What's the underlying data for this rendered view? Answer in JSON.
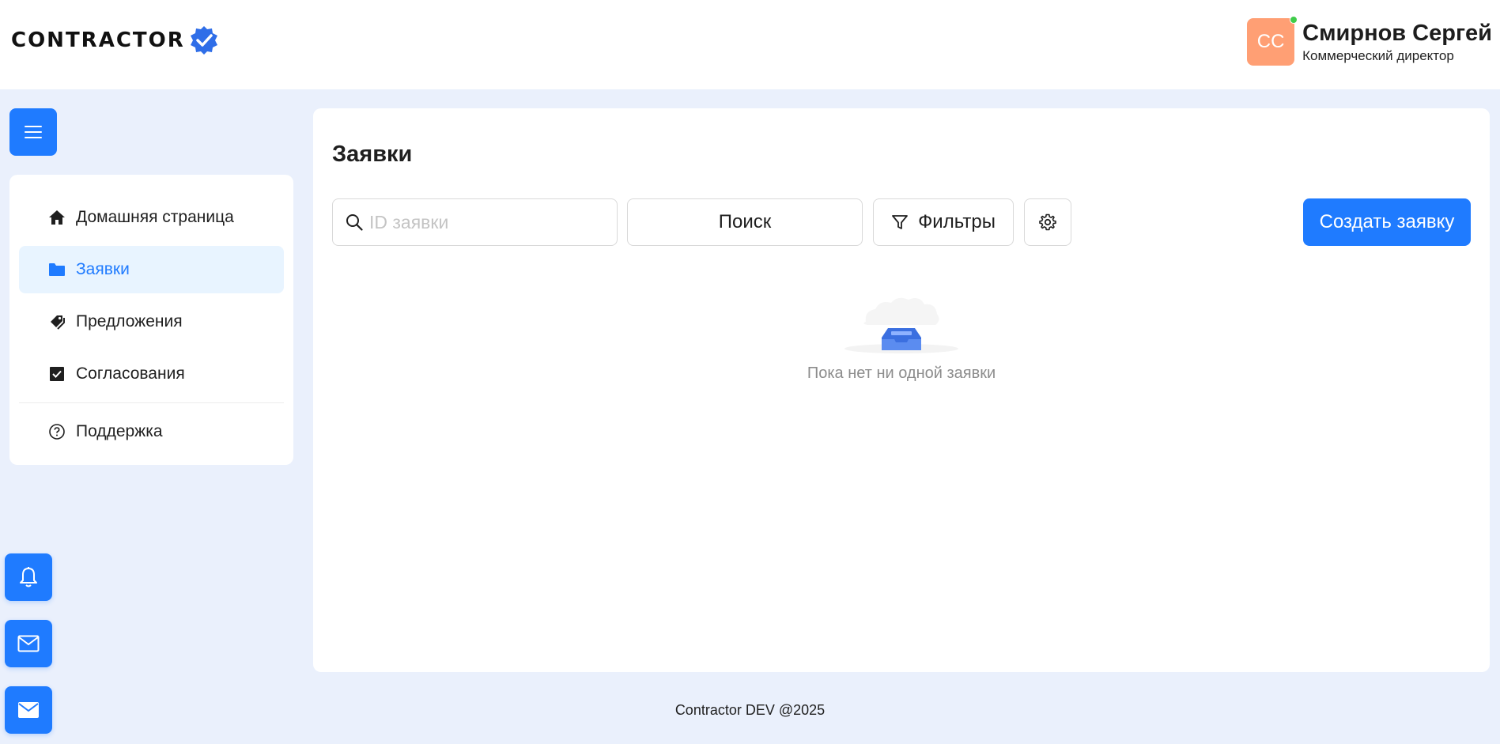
{
  "brand": {
    "name": "CONTRACTOR",
    "accent": "#1f7bff",
    "badge_color": "#2f6ee8"
  },
  "user": {
    "initials": "CC",
    "name": "Смирнов Сергей",
    "role": "Коммерческий директор",
    "avatar_color": "#ff9f74",
    "online": true
  },
  "sidebar": {
    "toggle_icon": "hamburger-icon",
    "items": [
      {
        "label": "Домашняя страница",
        "icon": "home-icon",
        "active": false
      },
      {
        "label": "Заявки",
        "icon": "folder-icon",
        "active": true
      },
      {
        "label": "Предложения",
        "icon": "tags-icon",
        "active": false
      },
      {
        "label": "Согласования",
        "icon": "checkbox-icon",
        "active": false
      },
      {
        "label": "Поддержка",
        "icon": "help-circle-icon",
        "active": false
      }
    ]
  },
  "fabs": [
    {
      "icon": "bell-icon"
    },
    {
      "icon": "mail-outline-icon"
    },
    {
      "icon": "mail-filled-icon"
    }
  ],
  "main": {
    "title": "Заявки",
    "search": {
      "placeholder": "ID заявки",
      "value": ""
    },
    "search_button": "Поиск",
    "filters_button": "Фильтры",
    "settings_icon": "gear-icon",
    "create_button": "Создать заявку",
    "empty_text": "Пока нет ни одной заявки"
  },
  "footer": {
    "text": "Contractor DEV @2025"
  }
}
